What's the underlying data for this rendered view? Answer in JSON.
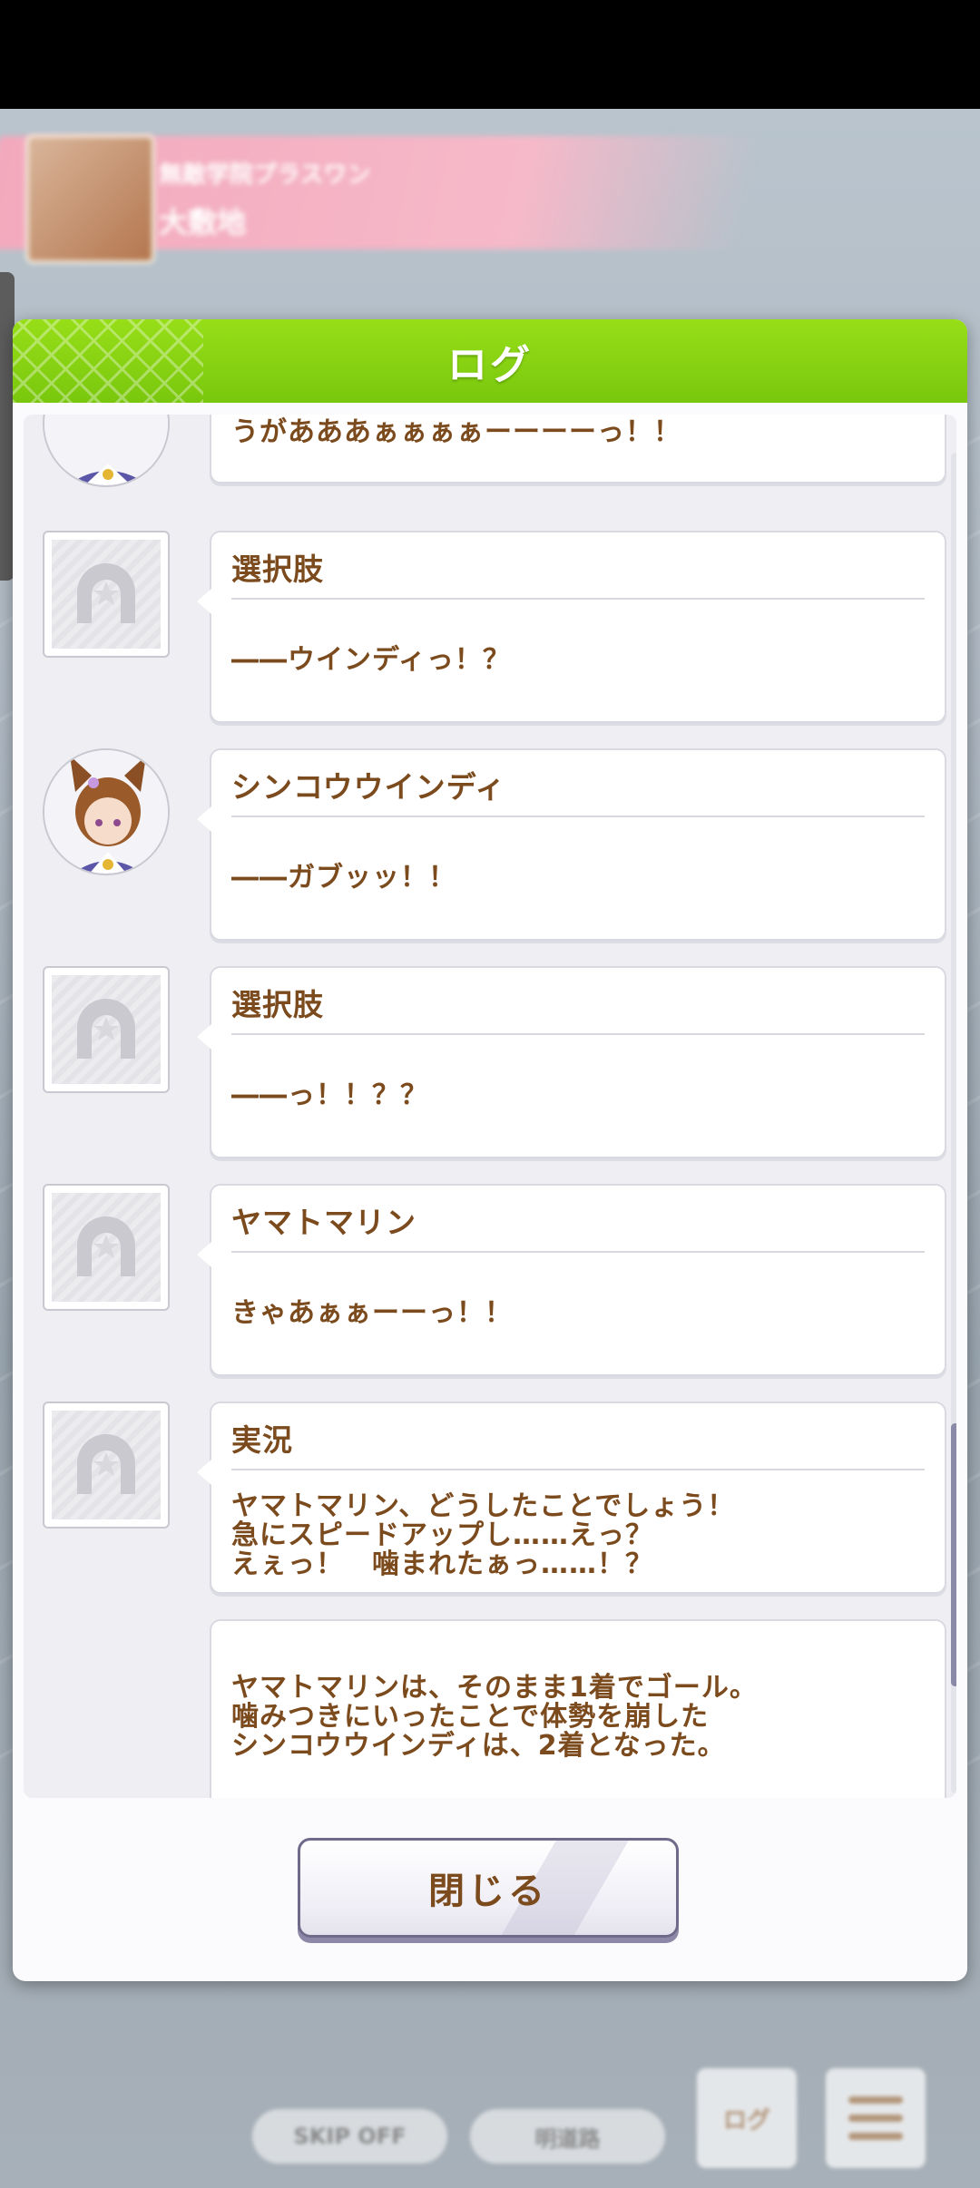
{
  "background": {
    "banner_line1": "無敵学院プラスワン",
    "banner_line2": "大敷地",
    "buttons": [
      "SKIP OFF",
      "明道路"
    ],
    "log_icon_label": "ログ"
  },
  "modal": {
    "title": "ログ",
    "close_label": "閉じる"
  },
  "log_entries": [
    {
      "speaker": "",
      "message": "うがあああぁぁぁぁーーーーっ！！",
      "avatar": "character-portrait"
    },
    {
      "speaker": "選択肢",
      "message": "――ウインディっ！？",
      "avatar": "horseshoe-placeholder-icon"
    },
    {
      "speaker": "シンコウウインディ",
      "message": "――ガブッッ！！",
      "avatar": "character-portrait"
    },
    {
      "speaker": "選択肢",
      "message": "――っ！！？？",
      "avatar": "horseshoe-placeholder-icon"
    },
    {
      "speaker": "ヤマトマリン",
      "message": "きゃあぁぁーーっ！！",
      "avatar": "horseshoe-placeholder-icon"
    },
    {
      "speaker": "実況",
      "message": "ヤマトマリン、どうしたことでしょう！\n急にスピードアップし……えっ？\nえぇっ！　噛まれたぁっ……！？",
      "avatar": "horseshoe-placeholder-icon"
    },
    {
      "speaker": "",
      "message": "ヤマトマリンは、そのまま1着でゴール。\n噛みつきにいったことで体勢を崩した\nシンコウウインディは、2着となった。",
      "avatar": ""
    }
  ]
}
